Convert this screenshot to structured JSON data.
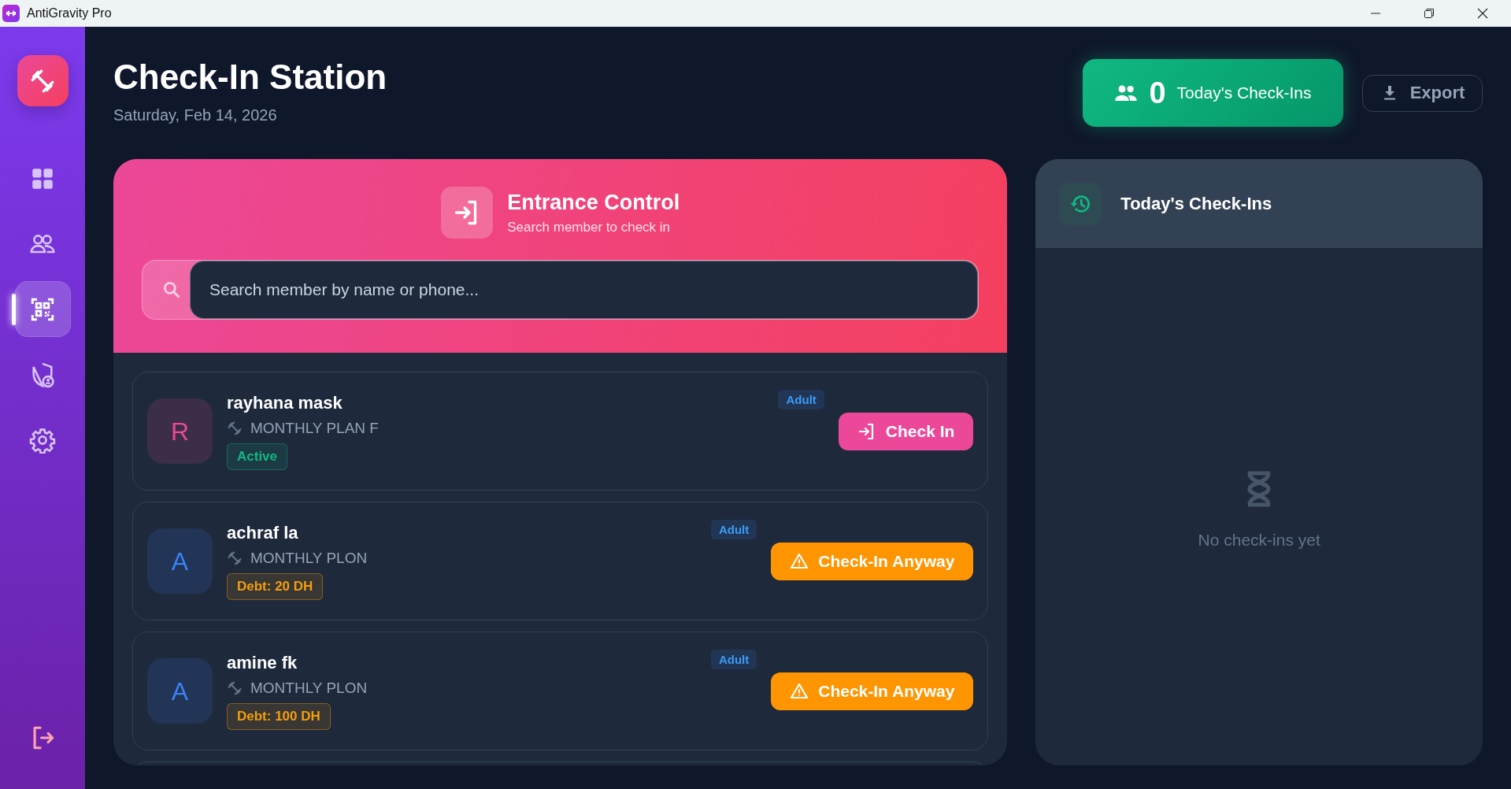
{
  "window": {
    "title": "AntiGravity Pro"
  },
  "sidebar": {
    "items": [
      {
        "selected": false
      },
      {
        "selected": false
      },
      {
        "selected": true
      },
      {
        "selected": false
      },
      {
        "selected": false
      }
    ]
  },
  "header": {
    "title": "Check-In Station",
    "date": "Saturday, Feb 14, 2026",
    "stat": {
      "count": "0",
      "label": "Today's Check-Ins"
    },
    "export_button": "Export"
  },
  "entrance": {
    "title": "Entrance Control",
    "subtitle": "Search member to check in",
    "search": {
      "placeholder": "Search member by name or phone..."
    }
  },
  "members": [
    {
      "initial": "R",
      "color": "#ec4899",
      "name": "rayhana mask",
      "plan": "MONTHLY PLAN F",
      "kind": "active",
      "status_label": "Active",
      "tag": "Adult",
      "button": "Check In"
    },
    {
      "initial": "A",
      "color": "#3b82f6",
      "name": "achraf la",
      "plan": "MONTHLY PLON",
      "kind": "debt",
      "status_label": "Debt: 20 DH",
      "tag": "Adult",
      "button": "Check-In Anyway"
    },
    {
      "initial": "A",
      "color": "#3b82f6",
      "name": "amine fk",
      "plan": "MONTHLY PLON",
      "kind": "debt",
      "status_label": "Debt: 100 DH",
      "tag": "Adult",
      "button": "Check-In Anyway"
    }
  ],
  "checkins": {
    "title": "Today's Check-Ins",
    "empty": "No check-ins yet"
  }
}
